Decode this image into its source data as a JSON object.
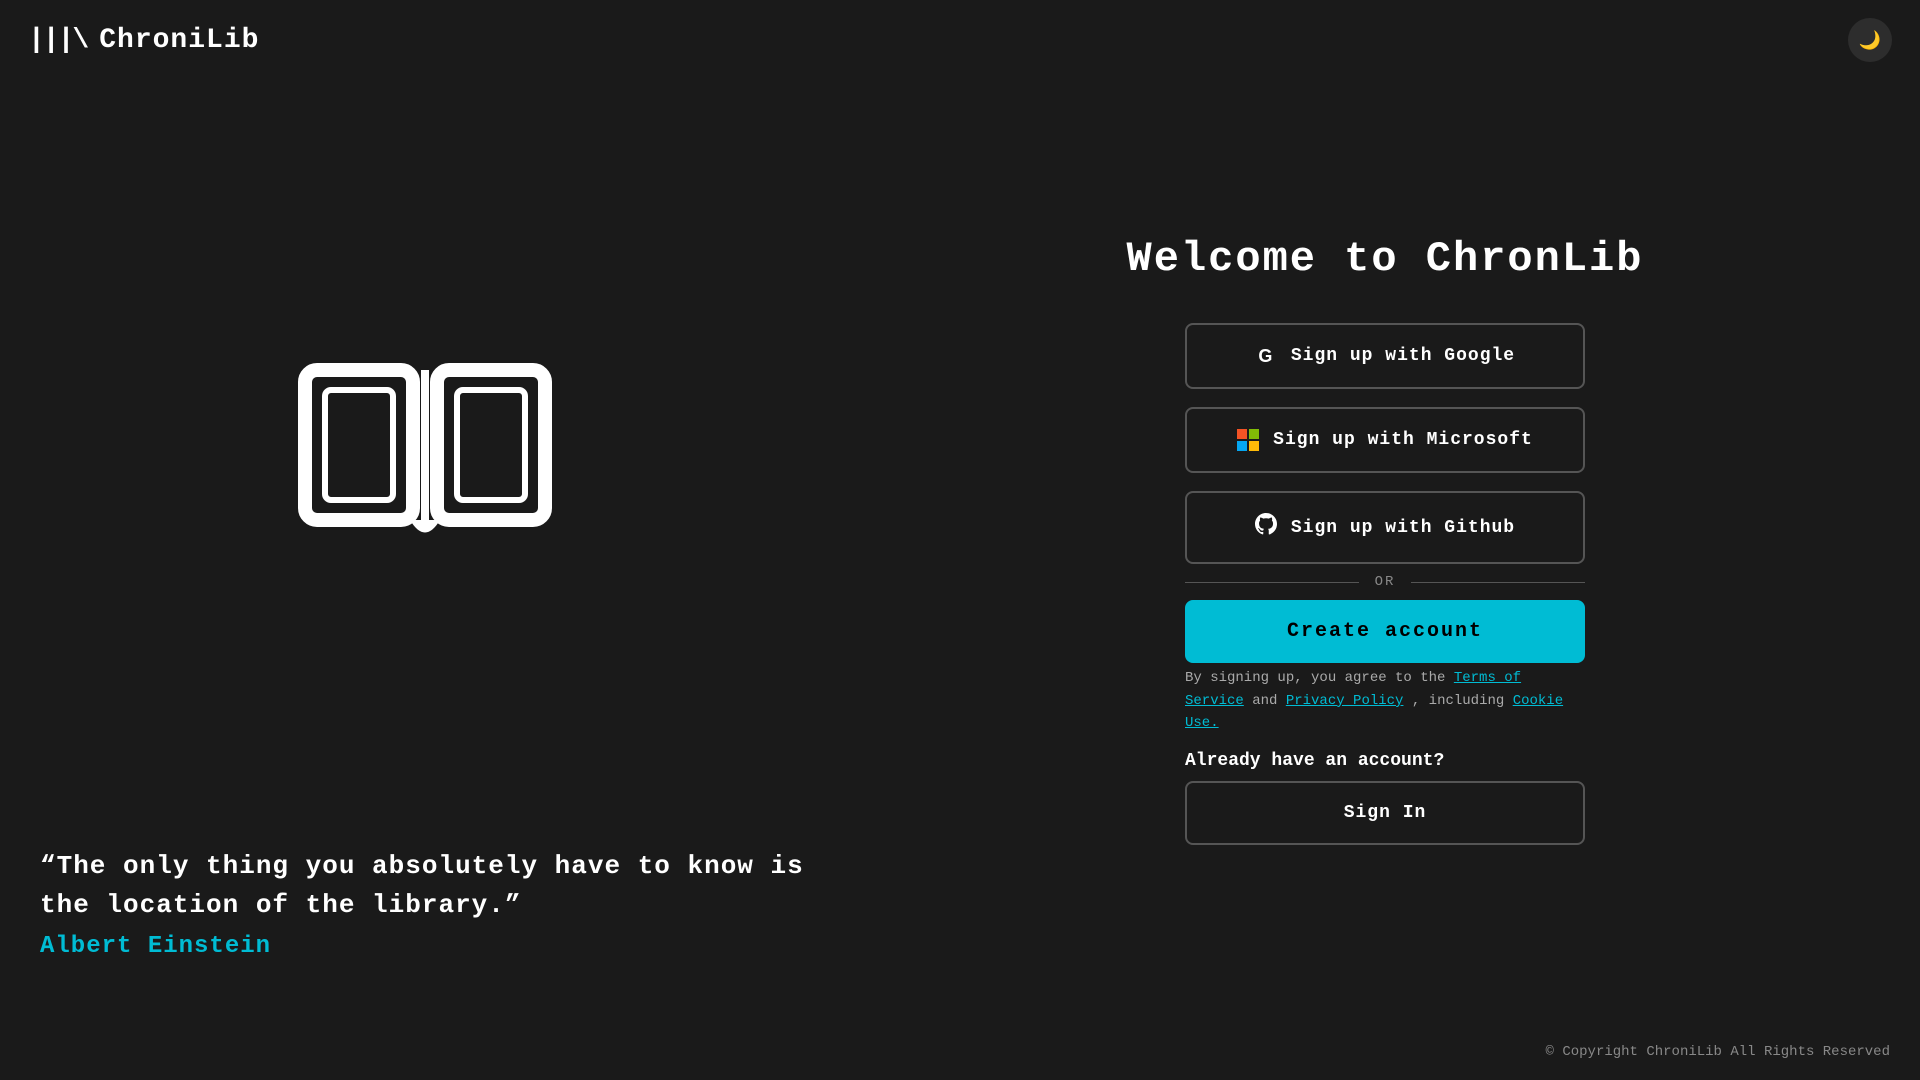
{
  "app": {
    "name": "ChroniLib",
    "logo_icon": "|||\\",
    "title": "Welcome to ChronLib"
  },
  "header": {
    "logo_text": "ChroniLib",
    "theme_toggle_icon": "moon"
  },
  "auth": {
    "google_button": "Sign up with Google",
    "microsoft_button": "Sign up with Microsoft",
    "github_button": "Sign up with Github",
    "or_label": "OR",
    "create_account_button": "Create account",
    "terms_prefix": "By signing up, you agree to the ",
    "terms_link": "Terms of Service",
    "terms_middle": " and ",
    "privacy_link": "Privacy Policy",
    "terms_suffix": ", including ",
    "cookie_link": "Cookie Use.",
    "already_account": "Already have an account?",
    "sign_in_button": "Sign In"
  },
  "quote": {
    "text": "“The only thing you absolutely have to know is\nthe location of the library.”",
    "author": "Albert Einstein"
  },
  "footer": {
    "copyright": "© Copyright ChroniLib All Rights Reserved"
  }
}
